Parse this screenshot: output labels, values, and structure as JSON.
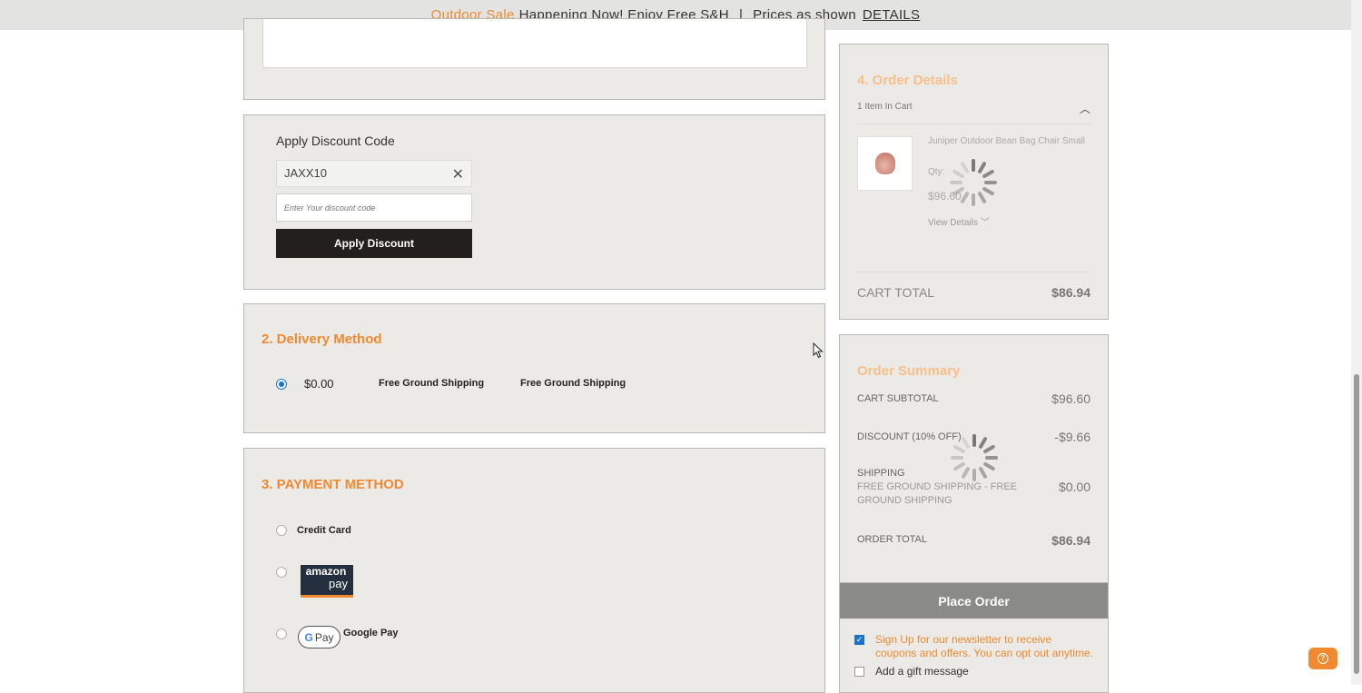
{
  "banner": {
    "sale_link": "Outdoor Sale",
    "message": "Happening Now! Enjoy Free S&H",
    "separator": "|",
    "prices_note": "Prices as shown",
    "details_link": "DETAILS"
  },
  "discount": {
    "label": "Apply Discount Code",
    "applied_code": "JAXX10",
    "input_placeholder": "Enter Your discount code",
    "apply_button": "Apply Discount"
  },
  "delivery": {
    "title": "2. Delivery Method",
    "option": {
      "price": "$0.00",
      "method": "Free Ground Shipping",
      "carrier": "Free Ground Shipping"
    }
  },
  "payment": {
    "title": "3. PAYMENT METHOD",
    "options": {
      "credit_card": "Credit Card",
      "amazon_line1": "amazon",
      "amazon_line2": "pay",
      "gpay_logo": "Pay",
      "gpay_logo_g": "G",
      "google_pay": "Google Pay"
    }
  },
  "order_details": {
    "title": "4. Order Details",
    "items_count": "1 Item In Cart",
    "product": {
      "name": "Juniper Outdoor Bean Bag Chair Small",
      "qty_label": "Qty:",
      "price": "$96.60",
      "view_details": "View Details"
    },
    "cart_total_label": "CART TOTAL",
    "cart_total_value": "$86.94"
  },
  "summary": {
    "title": "Order Summary",
    "subtotal_label": "CART SUBTOTAL",
    "subtotal_value": "$96.60",
    "discount_label": "DISCOUNT (10% OFF)",
    "discount_value": "-$9.66",
    "shipping_label": "SHIPPING",
    "shipping_detail": "FREE GROUND SHIPPING - FREE GROUND SHIPPING",
    "shipping_value": "$0.00",
    "order_total_label": "ORDER TOTAL",
    "order_total_value": "$86.94",
    "place_order": "Place Order",
    "newsletter": "Sign Up for our newsletter to receive coupons and offers. You can opt out anytime.",
    "gift": "Add a gift message"
  },
  "help": {
    "icon": "question-icon"
  },
  "colors": {
    "accent": "#f0892f",
    "accent_faded": "#f7bf8a",
    "panel_bg": "#ebeae6",
    "button_dark": "#231f1f",
    "button_disabled": "#8a8a86",
    "radio_selected": "#1a73c8"
  }
}
